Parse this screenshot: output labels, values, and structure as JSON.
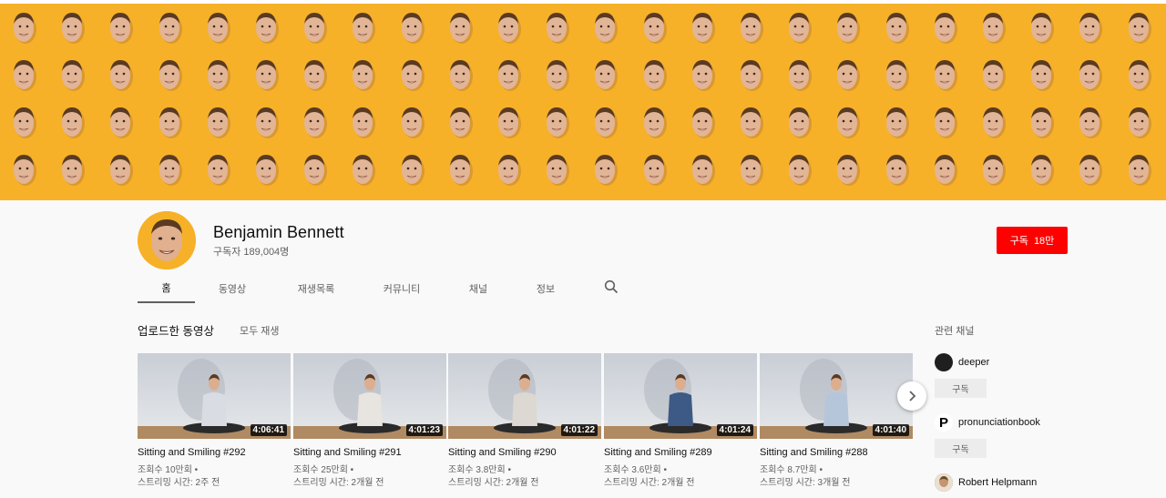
{
  "channel": {
    "name": "Benjamin Bennett",
    "subscribers": "구독자 189,004명",
    "subscribe_label": "구독",
    "subscribe_count": "18만",
    "brand_color": "#ff0000",
    "banner_color": "#f6b128"
  },
  "tabs": [
    {
      "label": "홈",
      "active": true
    },
    {
      "label": "동영상"
    },
    {
      "label": "재생목록"
    },
    {
      "label": "커뮤니티"
    },
    {
      "label": "채널"
    },
    {
      "label": "정보"
    }
  ],
  "search_icon": "search-icon",
  "uploads": {
    "title": "업로드한 동영상",
    "play_all": "모두 재생",
    "videos": [
      {
        "title": "Sitting and Smiling #292",
        "duration": "4:06:41",
        "views": "조회수 10만회 •",
        "streamed": "스트리밍 시간: 2주 전",
        "shirt": "#d9dde3"
      },
      {
        "title": "Sitting and Smiling #291",
        "duration": "4:01:23",
        "views": "조회수 25만회 •",
        "streamed": "스트리밍 시간: 2개월 전",
        "shirt": "#e8e4df"
      },
      {
        "title": "Sitting and Smiling #290",
        "duration": "4:01:22",
        "views": "조회수 3.8만회 •",
        "streamed": "스트리밍 시간: 2개월 전",
        "shirt": "#ddd8d2"
      },
      {
        "title": "Sitting and Smiling #289",
        "duration": "4:01:24",
        "views": "조회수 3.6만회 •",
        "streamed": "스트리밍 시간: 2개월 전",
        "shirt": "#3d5a86"
      },
      {
        "title": "Sitting and Smiling #288",
        "duration": "4:01:40",
        "views": "조회수 8.7만회 •",
        "streamed": "스트리밍 시간: 3개월 전",
        "shirt": "#b6c6da"
      }
    ]
  },
  "related": {
    "title": "관련 채널",
    "subscribe_label": "구독",
    "channels": [
      {
        "name": "deeper",
        "avatar_color": "#1f1f1f",
        "glyph": ""
      },
      {
        "name": "pronunciationbook",
        "avatar_color": "#ffffff",
        "glyph": "P"
      },
      {
        "name": "Robert Helpmann",
        "avatar_color": "#8a6a4a",
        "glyph": ""
      }
    ]
  }
}
